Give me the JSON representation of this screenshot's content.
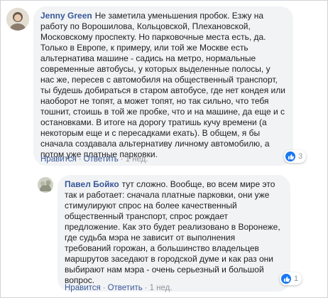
{
  "comments": [
    {
      "author": "Jenny Green",
      "text": "Не заметила уменьшения пробок. Езжу на работу по Ворошилова, Кольцовской, Плехановской, Московскому проспекту. Но парковочные места есть, да. Только в Европе, к примеру, или той же Москве есть альтернатива машине - садись на метро, нормальные современные автобусы, у которых выделенные полосы, у нас же, пересев с автомобиля на общественный транспорт, ты будешь добираться в старом автобусе, где нет кондея или наоборот не топят, а может топят, но так сильно, что тебя тошнит, стоишь в той же пробке, что и на машине, да еще и с остановками. В итоге на дорогу тратишь кучу времени (а некоторым еще и с пересадками ехать). В общем, я бы сначала создавала альтернативу личному автомобилю, а потом уже платные парковки.",
      "actions": {
        "like": "Нравится",
        "reply": "Ответить",
        "time": "1 нед."
      },
      "reaction_count": "3",
      "reaction_icon": "like-icon"
    },
    {
      "author": "Павел Бойко",
      "text": "тут сложно. Вообще, во всем мире это так и работает: сначала платные парковки, они уже стимулируют спрос на более качественный общественный транспорт, спрос рождает предложение. Как это будет реализовано в Воронеже, где судьба мэра не зависит от выполнения требований горожан, а большинство владельцев маршрутов заседают в городской думе и как раз они выбирают нам мэра - очень серьезный и большой вопрос.",
      "actions": {
        "like": "Нравится",
        "reply": "Ответить",
        "time": "1 нед."
      },
      "reaction_count": "1",
      "reaction_icon": "like-icon"
    }
  ],
  "separator": "·",
  "colors": {
    "link": "#385898",
    "bubble": "#f2f3f5",
    "like": "#1877f2",
    "meta": "#90949c"
  }
}
